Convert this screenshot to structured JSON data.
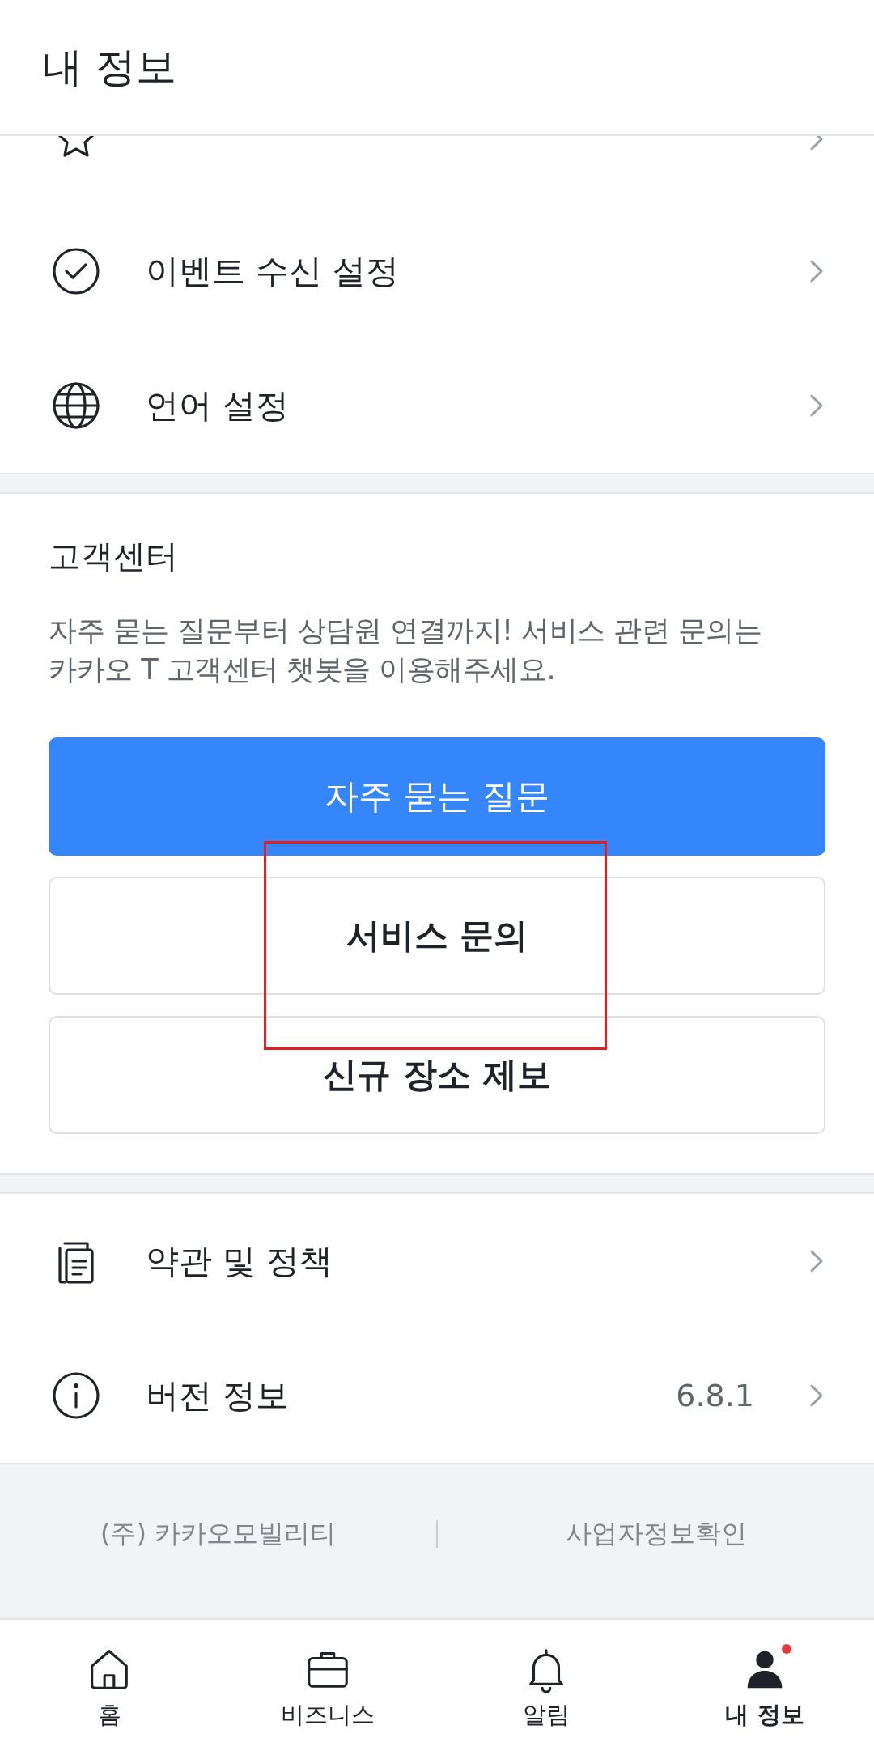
{
  "header": {
    "title": "내 정보"
  },
  "settings": [
    {
      "label": "이벤트 수신 설정"
    },
    {
      "label": "언어 설정"
    }
  ],
  "support": {
    "title": "고객센터",
    "description": "자주 묻는 질문부터 상담원 연결까지! 서비스 관련 문의는 카카오 T 고객센터 챗봇을 이용해주세요.",
    "buttons": [
      {
        "label": "자주 묻는 질문",
        "kind": "primary"
      },
      {
        "label": "서비스 문의",
        "kind": "outline"
      },
      {
        "label": "신규 장소 제보",
        "kind": "outline"
      }
    ]
  },
  "info": [
    {
      "label": "약관 및 정책"
    },
    {
      "label": "버전 정보",
      "value": "6.8.1"
    }
  ],
  "footer": {
    "company": "(주) 카카오모빌리티",
    "link": "사업자정보확인"
  },
  "nav": [
    {
      "label": "홈",
      "selected": false,
      "badge": false
    },
    {
      "label": "비즈니스",
      "selected": false,
      "badge": false
    },
    {
      "label": "알림",
      "selected": false,
      "badge": false
    },
    {
      "label": "내 정보",
      "selected": true,
      "badge": true
    }
  ],
  "annotation": {
    "kind": "rectangle"
  }
}
